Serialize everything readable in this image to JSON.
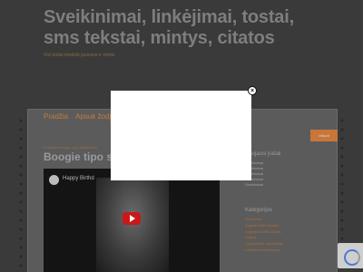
{
  "site": {
    "title_line1": "Sveikinimai, linkėjimai, tostai,",
    "title_line2": "sms tekstai, mintys, citatos",
    "tagline": "Visi būdai išreikšti jausmus ir mintis"
  },
  "nav": {
    "items": [
      "Pradžia",
      "Apsuk žodį"
    ]
  },
  "search": {
    "label": "Ieškoti"
  },
  "breadcrumb": {
    "home": "Pradžia",
    "sep": "»",
    "current": "Boogie tipo sveikinimai"
  },
  "post": {
    "title": "Boogie tipo sv"
  },
  "video": {
    "title": "Happy Birthd"
  },
  "sidebar": {
    "recent_heading": "Naujausi įrašai",
    "recent_items": [
      "Sveikinimai",
      "Sveikinimai",
      "Sveikinimai",
      "Sveikinimai",
      "Sveikinimai"
    ],
    "categories_heading": "Kategorijos",
    "categories": [
      "Anekdotai",
      "Angliški SMS tekstai",
      "Angliškos SMS citatos",
      "Citatos",
      "Gimtadienio sveikinimai",
      "Kalėdiniai sveikinimai"
    ]
  },
  "modal": {
    "close_glyph": "×"
  }
}
